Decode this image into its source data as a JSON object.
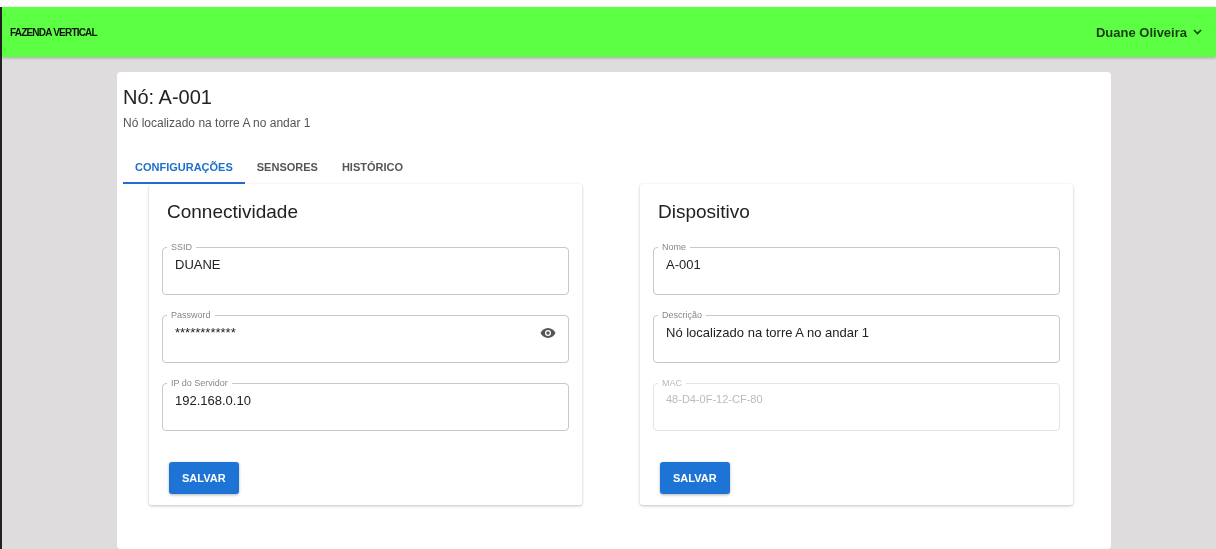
{
  "header": {
    "brand": "FAZENDA VERTICAL",
    "user": "Duane Oliveira"
  },
  "node": {
    "title": "Nó: A-001",
    "subtitle": "Nó localizado na torre A no andar 1"
  },
  "tabs": [
    {
      "label": "CONFIGURAÇÕES",
      "selected": true
    },
    {
      "label": "SENSORES",
      "selected": false
    },
    {
      "label": "HISTÓRICO",
      "selected": false
    }
  ],
  "panels": [
    {
      "title": "Connectividade",
      "button": "SALVAR",
      "fields": [
        {
          "label": "SSID",
          "value": "DUANE",
          "kind": "text",
          "disabled": false
        },
        {
          "label": "Password",
          "value": "************",
          "kind": "password",
          "disabled": false
        },
        {
          "label": "IP do Servidor",
          "value": "192.168.0.10",
          "kind": "text",
          "disabled": false
        }
      ]
    },
    {
      "title": "Dispositivo",
      "button": "SALVAR",
      "fields": [
        {
          "label": "Nome",
          "value": "A-001",
          "kind": "text",
          "disabled": false
        },
        {
          "label": "Descrição",
          "value": "Nó localizado na torre A no andar 1",
          "kind": "text",
          "disabled": false
        },
        {
          "label": "MAC",
          "value": "48-D4-0F-12-CF-80",
          "kind": "text",
          "disabled": true
        }
      ]
    }
  ]
}
